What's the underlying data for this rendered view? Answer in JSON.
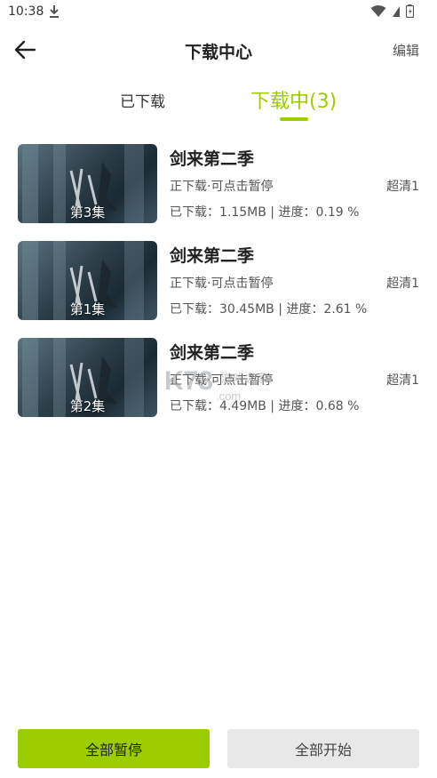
{
  "status_bar": {
    "time": "10:38"
  },
  "header": {
    "title": "下载中心",
    "edit_label": "编辑"
  },
  "tabs": [
    {
      "label": "已下载"
    },
    {
      "label": "下载中(3)"
    }
  ],
  "colors": {
    "accent": "#9ccd00",
    "secondary_button": "#e8e8e8"
  },
  "downloads": [
    {
      "title": "剑来第二季",
      "episode": "第3集",
      "status": "正下载·可点击暂停",
      "quality": "超清1",
      "progress": "已下载：1.15MB | 进度：0.19 %",
      "progress_percent": 0.19
    },
    {
      "title": "剑来第二季",
      "episode": "第1集",
      "status": "正下载·可点击暂停",
      "quality": "超清1",
      "progress": "已下载：30.45MB | 进度：2.61 %",
      "progress_percent": 2.61
    },
    {
      "title": "剑来第二季",
      "episode": "第2集",
      "status": "正下载·可点击暂停",
      "quality": "超清1",
      "progress": "已下载：4.49MB | 进度：0.68 %",
      "progress_percent": 0.68
    }
  ],
  "watermark": {
    "text": "K73 游戏之家 .com"
  },
  "bottom": {
    "pause_all": "全部暂停",
    "start_all": "全部开始"
  }
}
